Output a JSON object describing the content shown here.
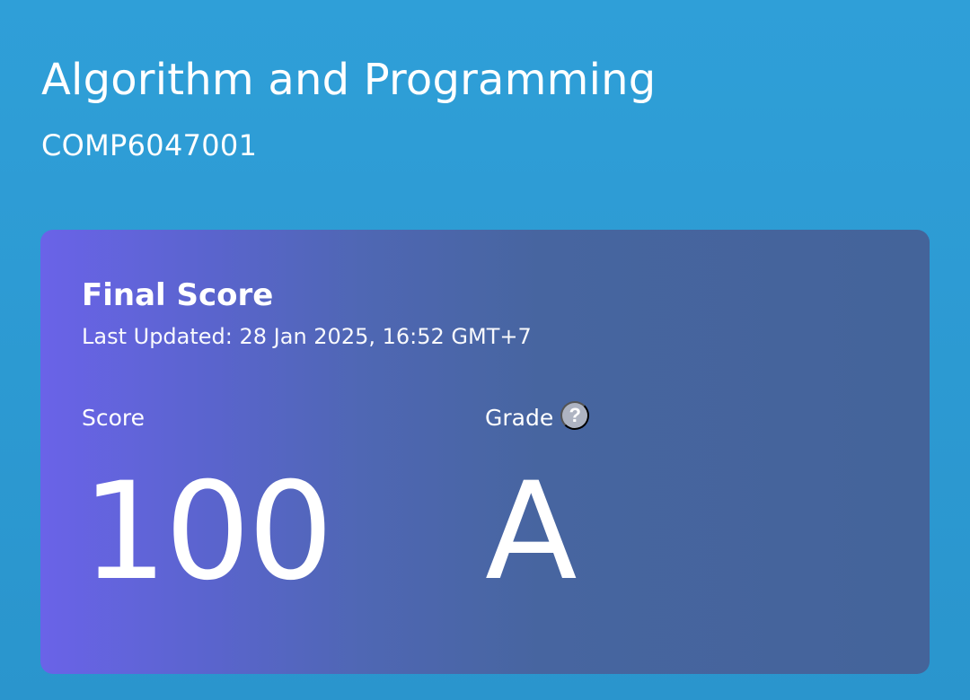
{
  "course": {
    "title": "Algorithm and Programming",
    "code": "COMP6047001"
  },
  "final_score_card": {
    "title": "Final Score",
    "last_updated": "Last Updated: 28 Jan 2025, 16:52 GMT+7",
    "score": {
      "label": "Score",
      "value": "100"
    },
    "grade": {
      "label": "Grade",
      "value": "A",
      "help_icon": "?"
    }
  },
  "colors": {
    "background": "#2f9fd8",
    "card_gradient_start": "#6a63e8",
    "card_gradient_end": "#44649a",
    "help_icon": "#aeb4c2",
    "text": "#ffffff"
  },
  "icons": {
    "grade_help": "help-icon"
  }
}
